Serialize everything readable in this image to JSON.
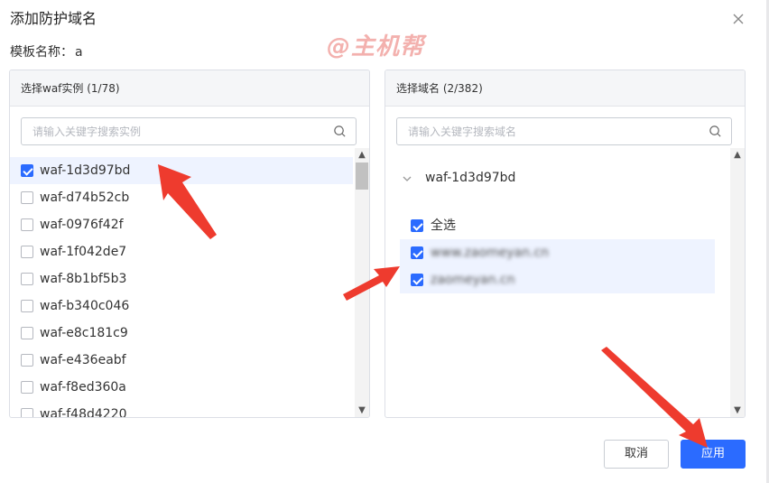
{
  "dialog": {
    "title": "添加防护域名",
    "template_label": "模板名称：",
    "template_value": "a"
  },
  "watermark": "@主机帮",
  "left_panel": {
    "header": "选择waf实例 (1/78)",
    "search_placeholder": "请输入关键字搜索实例",
    "items": [
      {
        "label": "waf-1d3d97bd",
        "checked": true
      },
      {
        "label": "waf-d74b52cb",
        "checked": false
      },
      {
        "label": "waf-0976f42f",
        "checked": false
      },
      {
        "label": "waf-1f042de7",
        "checked": false
      },
      {
        "label": "waf-8b1bf5b3",
        "checked": false
      },
      {
        "label": "waf-b340c046",
        "checked": false
      },
      {
        "label": "waf-e8c181c9",
        "checked": false
      },
      {
        "label": "waf-e436eabf",
        "checked": false
      },
      {
        "label": "waf-f8ed360a",
        "checked": false
      },
      {
        "label": "waf-f48d4220",
        "checked": false
      }
    ]
  },
  "right_panel": {
    "header": "选择域名 (2/382)",
    "search_placeholder": "请输入关键字搜索域名",
    "group": {
      "label": "waf-1d3d97bd",
      "select_all": "全选",
      "domains": [
        "www.zaomeyan.cn",
        "zaomeyan.cn"
      ]
    }
  },
  "footer": {
    "cancel": "取消",
    "apply": "应用"
  },
  "colors": {
    "accent": "#2b6bff",
    "annotation": "#ee3b2e"
  }
}
